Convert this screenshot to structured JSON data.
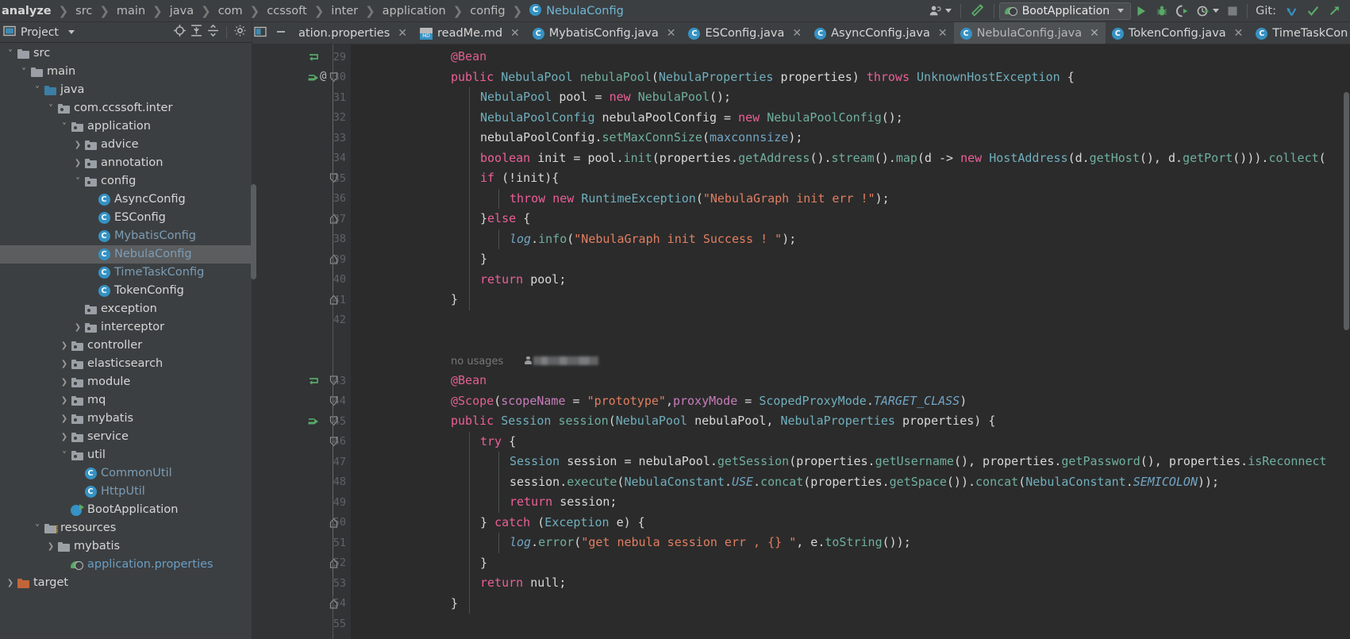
{
  "breadcrumbs": {
    "items": [
      {
        "label": "analyze",
        "type": "first"
      },
      {
        "label": "src",
        "type": "crumb"
      },
      {
        "label": "main",
        "type": "crumb"
      },
      {
        "label": "java",
        "type": "crumb"
      },
      {
        "label": "com",
        "type": "crumb"
      },
      {
        "label": "ccssoft",
        "type": "crumb"
      },
      {
        "label": "inter",
        "type": "crumb"
      },
      {
        "label": "application",
        "type": "crumb"
      },
      {
        "label": "config",
        "type": "crumb"
      },
      {
        "label": "NebulaConfig",
        "type": "class"
      }
    ]
  },
  "toolbar": {
    "run_config_name": "BootApplication",
    "git_label": "Git:",
    "icons": {
      "profile": "user-avatar-icon",
      "build": "hammer-icon",
      "run": "run-icon",
      "debug": "debug-icon",
      "coverage": "run-with-coverage-icon",
      "profiler": "profiler-icon",
      "stop": "stop-icon",
      "update": "vcs-update-icon",
      "commit": "vcs-commit-icon",
      "push": "vcs-push-icon"
    }
  },
  "project_pane": {
    "title": "Project",
    "header_icons": [
      "locate-icon",
      "expand-all-icon",
      "collapse-all-icon",
      "settings-gear-icon"
    ],
    "tree": [
      {
        "label": "src",
        "indent": 1,
        "arrow": "down",
        "icon": "folder",
        "state": "normal"
      },
      {
        "label": "main",
        "indent": 2,
        "arrow": "down",
        "icon": "folder",
        "state": "normal"
      },
      {
        "label": "java",
        "indent": 3,
        "arrow": "down",
        "icon": "folder-blue",
        "state": "normal"
      },
      {
        "label": "com.ccssoft.inter",
        "indent": 4,
        "arrow": "down",
        "icon": "folder-pkg",
        "state": "normal"
      },
      {
        "label": "application",
        "indent": 5,
        "arrow": "down",
        "icon": "folder-pkg",
        "state": "normal"
      },
      {
        "label": "advice",
        "indent": 6,
        "arrow": "right",
        "icon": "folder-pkg",
        "state": "normal"
      },
      {
        "label": "annotation",
        "indent": 6,
        "arrow": "right",
        "icon": "folder-pkg",
        "state": "normal"
      },
      {
        "label": "config",
        "indent": 6,
        "arrow": "down",
        "icon": "folder-pkg",
        "state": "normal"
      },
      {
        "label": "AsyncConfig",
        "indent": 7,
        "arrow": "none",
        "icon": "class",
        "state": "normal"
      },
      {
        "label": "ESConfig",
        "indent": 7,
        "arrow": "none",
        "icon": "class",
        "state": "normal"
      },
      {
        "label": "MybatisConfig",
        "indent": 7,
        "arrow": "none",
        "icon": "class",
        "state": "modified"
      },
      {
        "label": "NebulaConfig",
        "indent": 7,
        "arrow": "none",
        "icon": "class",
        "state": "modified",
        "selected": true
      },
      {
        "label": "TimeTaskConfig",
        "indent": 7,
        "arrow": "none",
        "icon": "class",
        "state": "modified"
      },
      {
        "label": "TokenConfig",
        "indent": 7,
        "arrow": "none",
        "icon": "class",
        "state": "normal"
      },
      {
        "label": "exception",
        "indent": 6,
        "arrow": "none",
        "icon": "folder-pkg",
        "state": "normal"
      },
      {
        "label": "interceptor",
        "indent": 6,
        "arrow": "right",
        "icon": "folder-pkg",
        "state": "normal"
      },
      {
        "label": "controller",
        "indent": 5,
        "arrow": "right",
        "icon": "folder-pkg",
        "state": "normal"
      },
      {
        "label": "elasticsearch",
        "indent": 5,
        "arrow": "right",
        "icon": "folder-pkg",
        "state": "normal"
      },
      {
        "label": "module",
        "indent": 5,
        "arrow": "right",
        "icon": "folder-pkg",
        "state": "normal"
      },
      {
        "label": "mq",
        "indent": 5,
        "arrow": "right",
        "icon": "folder-pkg",
        "state": "normal"
      },
      {
        "label": "mybatis",
        "indent": 5,
        "arrow": "right",
        "icon": "folder-pkg",
        "state": "normal"
      },
      {
        "label": "service",
        "indent": 5,
        "arrow": "right",
        "icon": "folder-pkg",
        "state": "normal"
      },
      {
        "label": "util",
        "indent": 5,
        "arrow": "down",
        "icon": "folder-pkg",
        "state": "normal"
      },
      {
        "label": "CommonUtil",
        "indent": 6,
        "arrow": "none",
        "icon": "class",
        "state": "modified"
      },
      {
        "label": "HttpUtil",
        "indent": 6,
        "arrow": "none",
        "icon": "class",
        "state": "modified"
      },
      {
        "label": "BootApplication",
        "indent": 5,
        "arrow": "none",
        "icon": "spring-boot",
        "state": "normal"
      },
      {
        "label": "resources",
        "indent": 3,
        "arrow": "down",
        "icon": "folder-res",
        "state": "normal"
      },
      {
        "label": "mybatis",
        "indent": 4,
        "arrow": "right",
        "icon": "folder",
        "state": "normal"
      },
      {
        "label": "application.properties",
        "indent": 5,
        "arrow": "none",
        "icon": "spring-leaf",
        "state": "properties"
      },
      {
        "label": "target",
        "indent": 1,
        "arrow": "right",
        "icon": "folder-orange",
        "state": "normal"
      }
    ]
  },
  "tabs": [
    {
      "label": "ation.properties",
      "icon": "properties-icon",
      "active": false,
      "truncated_left": true
    },
    {
      "label": "readMe.md",
      "icon": "markdown-icon",
      "active": false
    },
    {
      "label": "MybatisConfig.java",
      "icon": "class-icon",
      "active": false
    },
    {
      "label": "ESConfig.java",
      "icon": "class-icon",
      "active": false
    },
    {
      "label": "AsyncConfig.java",
      "icon": "class-icon",
      "active": false
    },
    {
      "label": "NebulaConfig.java",
      "icon": "class-icon",
      "active": true
    },
    {
      "label": "TokenConfig.java",
      "icon": "class-icon",
      "active": false
    },
    {
      "label": "TimeTaskCon",
      "icon": "class-icon",
      "active": false,
      "truncated_right": true
    }
  ],
  "editor": {
    "inlay_hint": "no usages",
    "line_numbers": [
      29,
      30,
      31,
      32,
      33,
      34,
      35,
      36,
      37,
      38,
      39,
      40,
      41,
      42,
      "",
      "",
      43,
      44,
      45,
      46,
      47,
      48,
      49,
      50,
      51,
      52,
      53,
      54,
      55
    ],
    "lines": [
      {
        "num": 29,
        "text": "@Bean",
        "indent": 0
      },
      {
        "num": 30,
        "text": "public NebulaPool nebulaPool(NebulaProperties properties) throws UnknownHostException {",
        "indent": 0
      },
      {
        "num": 31,
        "text": "NebulaPool pool = new NebulaPool();",
        "indent": 1
      },
      {
        "num": 32,
        "text": "NebulaPoolConfig nebulaPoolConfig = new NebulaPoolConfig();",
        "indent": 1
      },
      {
        "num": 33,
        "text": "nebulaPoolConfig.setMaxConnSize(maxconnsize);",
        "indent": 1
      },
      {
        "num": 34,
        "text": "boolean init = pool.init(properties.getAddress().stream().map(d -> new HostAddress(d.getHost(), d.getPort())).collect(",
        "indent": 1
      },
      {
        "num": 35,
        "text": "if (!init){",
        "indent": 1
      },
      {
        "num": 36,
        "text": "throw new RuntimeException(\"NebulaGraph init err !\");",
        "indent": 2
      },
      {
        "num": 37,
        "text": "}else {",
        "indent": 1
      },
      {
        "num": 38,
        "text": "log.info(\"NebulaGraph init Success ! \");",
        "indent": 2
      },
      {
        "num": 39,
        "text": "}",
        "indent": 1
      },
      {
        "num": 40,
        "text": "return pool;",
        "indent": 1
      },
      {
        "num": 41,
        "text": "}",
        "indent": 0
      },
      {
        "num": 42,
        "text": "",
        "indent": 0
      },
      {
        "num": 43,
        "text": "@Bean",
        "indent": 0
      },
      {
        "num": 44,
        "text": "@Scope(scopeName = \"prototype\",proxyMode = ScopedProxyMode.TARGET_CLASS)",
        "indent": 0
      },
      {
        "num": 45,
        "text": "public Session session(NebulaPool nebulaPool, NebulaProperties properties) {",
        "indent": 0
      },
      {
        "num": 46,
        "text": "try {",
        "indent": 1
      },
      {
        "num": 47,
        "text": "Session session = nebulaPool.getSession(properties.getUsername(), properties.getPassword(), properties.isReconnect",
        "indent": 2
      },
      {
        "num": 48,
        "text": "session.execute(NebulaConstant.USE.concat(properties.getSpace()).concat(NebulaConstant.SEMICOLON));",
        "indent": 2
      },
      {
        "num": 49,
        "text": "return session;",
        "indent": 2
      },
      {
        "num": 50,
        "text": "} catch (Exception e) {",
        "indent": 1
      },
      {
        "num": 51,
        "text": "log.error(\"get nebula session err , {} \", e.toString());",
        "indent": 2
      },
      {
        "num": 52,
        "text": "}",
        "indent": 1
      },
      {
        "num": 53,
        "text": "return null;",
        "indent": 1
      },
      {
        "num": 54,
        "text": "}",
        "indent": 0
      },
      {
        "num": 55,
        "text": "",
        "indent": 0
      }
    ]
  },
  "colors": {
    "background": "#2b2b2b",
    "panel": "#3c3f41",
    "gutter": "#313335",
    "accent_blue": "#3592c4",
    "keyword_orange": "#cc7832",
    "keyword_pink": "#ec5f97",
    "string_orange": "#e27e61",
    "annotation_pink": "#e05f8f",
    "type_cyan": "#6fafbd",
    "method_teal": "#6faf9e",
    "selection": "#5b5d5f",
    "green_run": "#59a869"
  }
}
